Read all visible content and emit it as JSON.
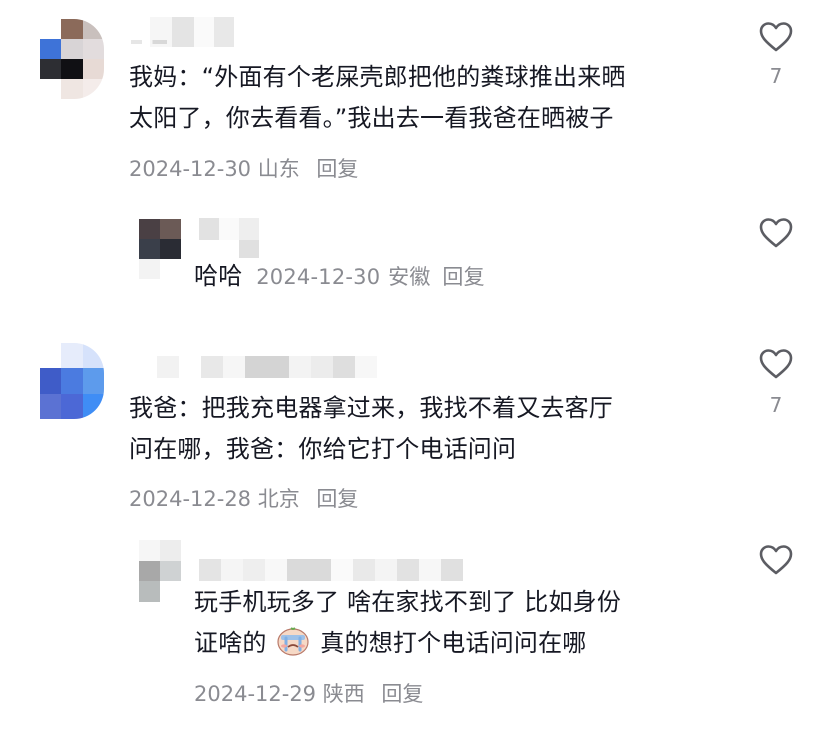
{
  "comments": [
    {
      "text_line1": "我妈：“外面有个老屎壳郎把他的粪球推出来晒",
      "text_line2": "太阳了，你去看看。”我出去一看我爸在晒被子",
      "date": "2024-12-30",
      "location": "山东",
      "reply_label": "回复",
      "like_count": "7"
    },
    {
      "text": "哈哈",
      "date": "2024-12-30",
      "location": "安徽",
      "reply_label": "回复"
    },
    {
      "text_line1": "我爸：把我充电器拿过来，我找不着又去客厅",
      "text_line2": "问在哪，我爸：你给它打个电话问问",
      "date": "2024-12-28",
      "location": "北京",
      "reply_label": "回复",
      "like_count": "7"
    },
    {
      "text_line1": "玩手机玩多了 啥在家找不到了 比如身份",
      "text_line2_a": "证啥的",
      "text_line2_b": "真的想打个电话问问在哪",
      "emoji": "crying-emoji",
      "date": "2024-12-29",
      "location": "陕西",
      "reply_label": "回复"
    }
  ],
  "colors": {
    "text": "#161823",
    "meta": "#8a8b91",
    "icon": "#5c5d63"
  }
}
